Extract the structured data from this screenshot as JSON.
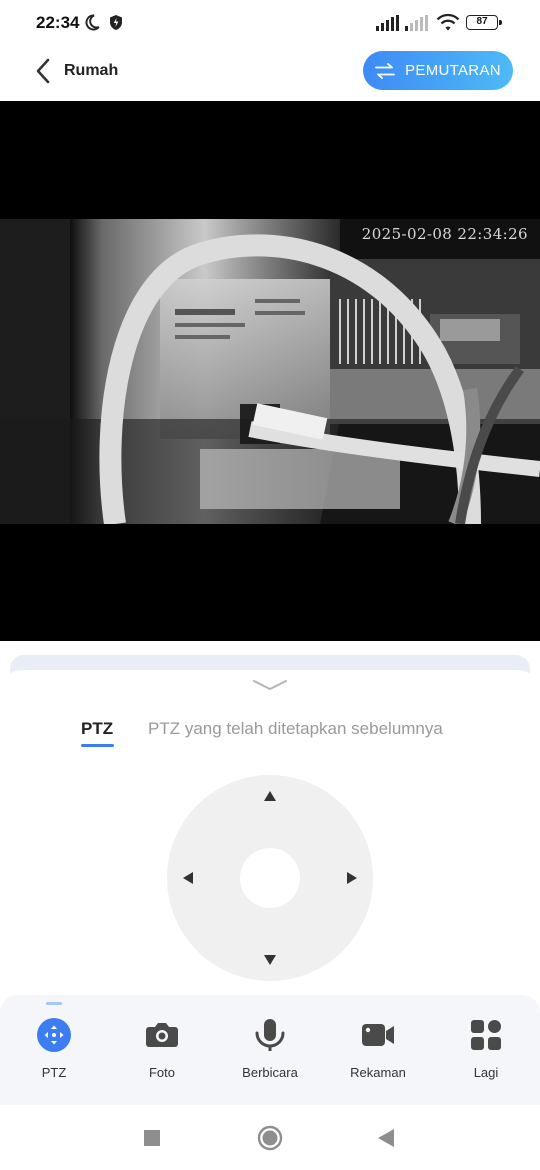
{
  "status_bar": {
    "time": "22:34",
    "battery": "87"
  },
  "header": {
    "back_label": "Rumah",
    "playback_label": "PEMUTARAN"
  },
  "video": {
    "timestamp": "2025-02-08  22:34:26"
  },
  "ptz_panel": {
    "tab_active": "PTZ",
    "tab_preset": "PTZ yang telah ditetapkan sebelumnya"
  },
  "toolbar": {
    "items": [
      {
        "label": "PTZ",
        "icon": "ptz-icon"
      },
      {
        "label": "Foto",
        "icon": "camera-icon"
      },
      {
        "label": "Berbicara",
        "icon": "microphone-icon"
      },
      {
        "label": "Rekaman",
        "icon": "video-camera-icon"
      },
      {
        "label": "Lagi",
        "icon": "grid-icon"
      }
    ]
  },
  "colors": {
    "accent": "#3c7ef2",
    "gradient_start": "#3d8bf5",
    "gradient_end": "#4dbaf6"
  }
}
